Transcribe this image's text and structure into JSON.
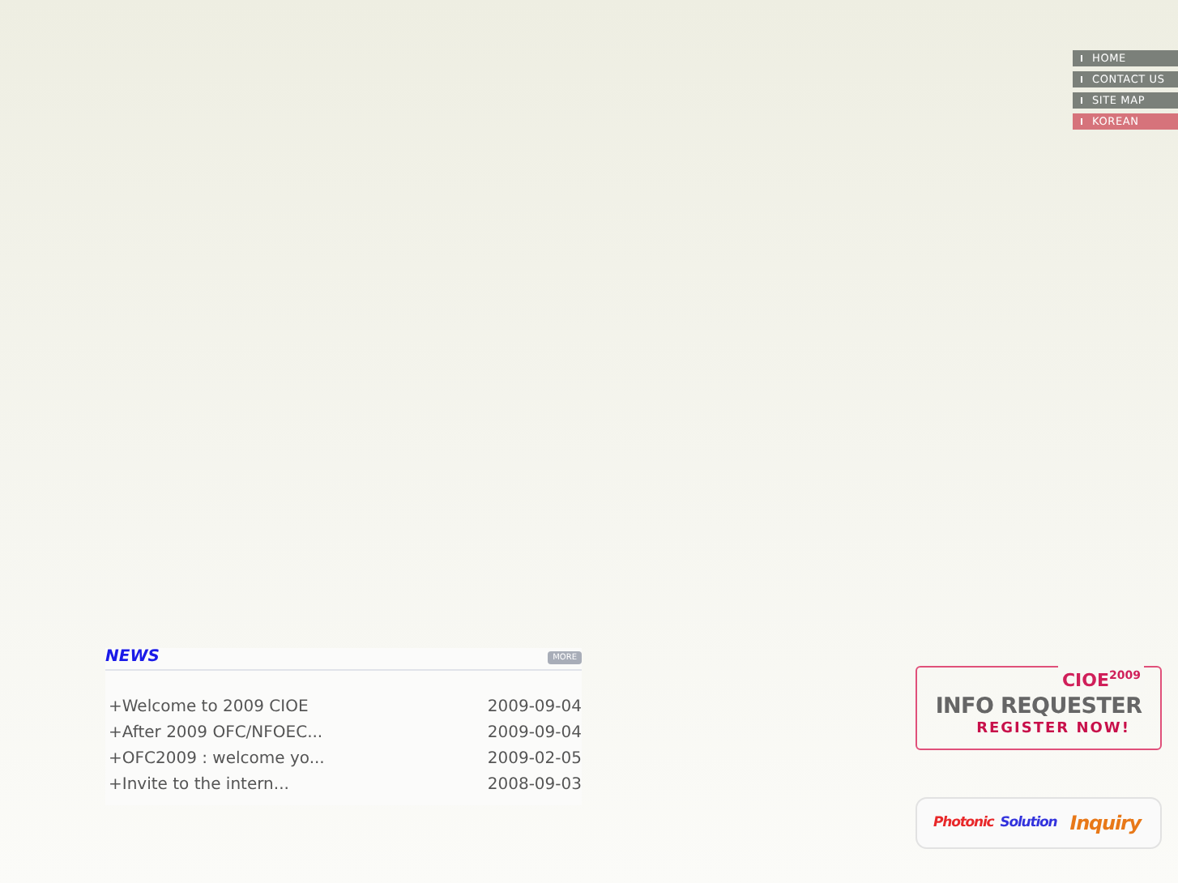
{
  "top_nav": [
    {
      "label": "HOME",
      "color": "#7b807a"
    },
    {
      "label": "CONTACT US",
      "color": "#7b807a"
    },
    {
      "label": "SITE MAP",
      "color": "#7b807a"
    },
    {
      "label": "KOREAN",
      "color": "#d6737b"
    }
  ],
  "news": {
    "title": "NEWS",
    "more": "MORE",
    "items": [
      {
        "title": "+Welcome to 2009 CIOE",
        "date": "2009-09-04"
      },
      {
        "title": "+After 2009 OFC/NFOEC...",
        "date": "2009-09-04"
      },
      {
        "title": "+OFC2009 : welcome yo...",
        "date": "2009-02-05"
      },
      {
        "title": "+Invite to the intern...",
        "date": "2008-09-03"
      }
    ]
  },
  "register_banner": {
    "brand": "CIOE",
    "year": "2009",
    "title": "INFO REQUESTER",
    "cta": "REGISTER NOW!"
  },
  "inquiry_banner": {
    "word_1": "Photonic",
    "word_2": "Solution",
    "word_3": "Inquiry"
  }
}
